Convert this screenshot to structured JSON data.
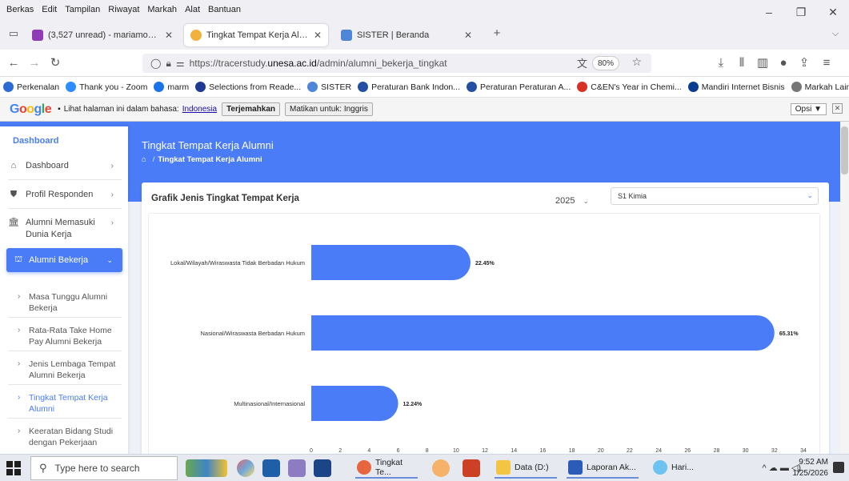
{
  "menubar": [
    "Berkas",
    "Edit",
    "Tampilan",
    "Riwayat",
    "Markah",
    "Alat",
    "Bantuan"
  ],
  "tabs": [
    {
      "label": "(3,527 unread) - mariamonicasi",
      "favicon_color": "#8f3bb5",
      "active": false
    },
    {
      "label": "Tingkat Tempat Kerja Alumni | T",
      "favicon_color": "#f0b23c",
      "active": true
    },
    {
      "label": "SISTER | Beranda",
      "favicon_color": "#4f86d9",
      "active": false
    }
  ],
  "address": {
    "url_prefix": "https://tracerstudy.",
    "url_domain": "unesa.ac.id",
    "url_path": "/admin/alumni_bekerja_tingkat",
    "zoom": "80%"
  },
  "bookmarks": [
    {
      "label": "Perkenalan",
      "color": "#2c6bd6"
    },
    {
      "label": "Thank you - Zoom",
      "color": "#2d8cff"
    },
    {
      "label": "marm",
      "color": "#1a73e8"
    },
    {
      "label": "Selections from Reade...",
      "color": "#1f3a93"
    },
    {
      "label": "SISTER",
      "color": "#4f86d9"
    },
    {
      "label": "Peraturan Bank Indon...",
      "color": "#2450a4"
    },
    {
      "label": "Peraturan Peraturan A...",
      "color": "#2450a4"
    },
    {
      "label": "C&EN's Year in Chemi...",
      "color": "#d93025"
    },
    {
      "label": "Mandiri Internet Bisnis",
      "color": "#0a3d91"
    },
    {
      "label": "Markah Lain",
      "color": "#777777"
    }
  ],
  "gtranslate": {
    "prompt": "Lihat halaman ini dalam bahasa:",
    "language": "Indonesia",
    "translate_btn": "Terjemahkan",
    "disable_btn": "Matikan untuk: Inggris",
    "options": "Opsi ▼"
  },
  "sidebar": {
    "section": "Dashboard",
    "items": [
      {
        "label": "Dashboard",
        "icon": "home-icon"
      },
      {
        "label": "Profil Responden",
        "icon": "user-profile-icon"
      },
      {
        "label": "Alumni Memasuki Dunia Kerja",
        "icon": "building-icon"
      }
    ],
    "active_item": "Alumni Bekerja",
    "sub_items": [
      {
        "label": "Masa Tunggu Alumni Bekerja",
        "active": false
      },
      {
        "label": "Rata-Rata Take Home Pay Alumni Bekerja",
        "active": false
      },
      {
        "label": "Jenis Lembaga Tempat Alumni Bekerja",
        "active": false
      },
      {
        "label": "Tingkat Tempat Kerja Alumni",
        "active": true
      },
      {
        "label": "Keeratan Bidang Studi dengan Pekerjaan",
        "active": false
      }
    ]
  },
  "header": {
    "title": "Tingkat Tempat Kerja Alumni",
    "breadcrumb": "Tingkat Tempat Kerja Alumni"
  },
  "card": {
    "title": "Grafik Jenis Tingkat Tempat Kerja",
    "year": "2025",
    "program": "S1 Kimia"
  },
  "chart_data": {
    "type": "bar",
    "orientation": "horizontal",
    "categories": [
      "Lokal/Wilayah/Wiraswasta Tidak Berbadan Hukum",
      "Nasional/Wiraswasta Berbadan Hukum",
      "Multinasional/Internasional"
    ],
    "values": [
      11,
      32,
      6
    ],
    "data_labels": [
      "22.45%",
      "65.31%",
      "12.24%"
    ],
    "xlim": [
      0,
      34
    ],
    "xticks": [
      0,
      2,
      4,
      6,
      8,
      10,
      12,
      14,
      16,
      18,
      20,
      22,
      24,
      26,
      28,
      30,
      32,
      34
    ],
    "bar_color": "#4a7cf7",
    "grid": false
  },
  "taskbar": {
    "search_placeholder": "Type here to search",
    "apps": [
      {
        "label": "Tingkat Te...",
        "color": "#e8663d"
      },
      {
        "label": "Data (D:)",
        "color": "#f4c542"
      },
      {
        "label": "Laporan Ak...",
        "color": "#2b5cb8"
      },
      {
        "label": "Hari...",
        "color": "#6cc3f2"
      }
    ],
    "time": "9:52 AM",
    "date": "1/25/2026"
  },
  "colors": {
    "primary": "#4a7cf7",
    "sidebar_bg": "#ffffff",
    "page_bg": "#eef1f7"
  }
}
